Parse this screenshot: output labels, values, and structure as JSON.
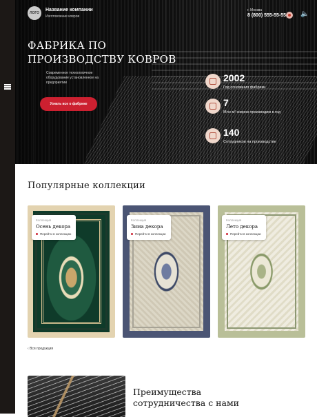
{
  "header": {
    "logo_text": "ЛОГО",
    "company_name": "Название компании",
    "company_slogan": "Изготовление ковров",
    "city": "г. Москва",
    "phone": "8 (800) 555-55-55"
  },
  "hero": {
    "title": "ФАБРИКА ПО ПРОИЗВОДСТВУ КОВРОВ",
    "subtitle": "Современное технологичное оборудование установленное на предприятии",
    "button": "Узнать все о фабрике"
  },
  "stats": [
    {
      "number": "2002",
      "label": "Год основания фабрики",
      "icon": "award-icon"
    },
    {
      "number": "7",
      "label": "Млн м² ковров производим в год",
      "icon": "carpet-icon"
    },
    {
      "number": "140",
      "label": "Сотрудников на производстве",
      "icon": "people-icon"
    }
  ],
  "collections": {
    "title": "Популярные коллекции",
    "items": [
      {
        "kind": "Коллекция",
        "name": "Осень декора",
        "link": "Перейти в коллекцию"
      },
      {
        "kind": "Коллекция",
        "name": "Зима декора",
        "link": "Перейти в коллекции"
      },
      {
        "kind": "Коллекция",
        "name": "Лето декора",
        "link": "Перейти в коллекции"
      }
    ],
    "all_link": "Вся продукция"
  },
  "advantages": {
    "title": "Преимущества сотрудничества с нами"
  },
  "colors": {
    "accent": "#cc2030",
    "dark_strip": "#1c1816"
  }
}
